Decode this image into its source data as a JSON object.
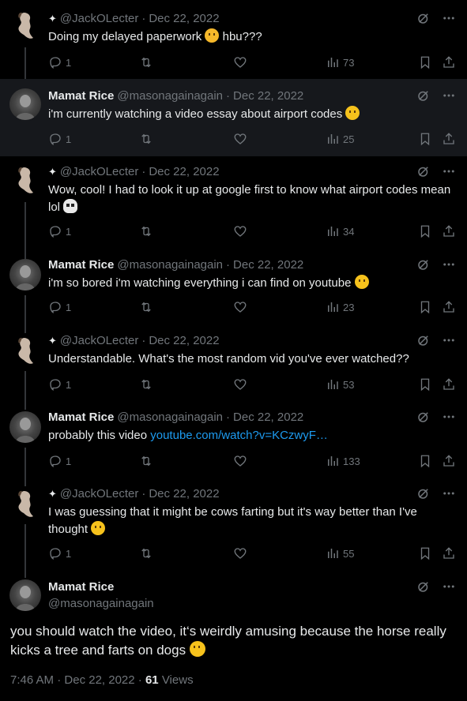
{
  "colors": {
    "background": "#000000",
    "highlight": "#16181c",
    "text": "#e7e9ea",
    "muted": "#71767b",
    "link": "#1d9bf0"
  },
  "replies": [
    {
      "author": "jack",
      "name": "",
      "handle": "@JackOLecter",
      "date": "Dec 22, 2022",
      "text": "Doing my delayed paperwork",
      "emoji": "yawning-face",
      "text_after": " hbu???",
      "replies": "1",
      "views": "73"
    },
    {
      "author": "mamat",
      "name": "Mamat Rice",
      "handle": "@masonagainagain",
      "date": "Dec 22, 2022",
      "text": "i'm currently watching a video essay about airport codes",
      "emoji": "grinning-face",
      "text_after": "",
      "replies": "1",
      "views": "25"
    },
    {
      "author": "jack",
      "name": "",
      "handle": "@JackOLecter",
      "date": "Dec 22, 2022",
      "text": "Wow, cool! I had to look it up at google first to know what airport codes mean lol",
      "emoji": "skull",
      "text_after": "",
      "replies": "1",
      "views": "34"
    },
    {
      "author": "mamat",
      "name": "Mamat Rice",
      "handle": "@masonagainagain",
      "date": "Dec 22, 2022",
      "text": "i'm so bored i'm watching everything i can find on youtube",
      "emoji": "tears-of-joy",
      "text_after": "",
      "replies": "1",
      "views": "23"
    },
    {
      "author": "jack",
      "name": "",
      "handle": "@JackOLecter",
      "date": "Dec 22, 2022",
      "text": "Understandable. What's the most random vid you've ever watched??",
      "emoji": "",
      "text_after": "",
      "replies": "1",
      "views": "53"
    },
    {
      "author": "mamat",
      "name": "Mamat Rice",
      "handle": "@masonagainagain",
      "date": "Dec 22, 2022",
      "text": "probably this video ",
      "link": "youtube.com/watch?v=KCzwyF…",
      "emoji": "",
      "text_after": "",
      "replies": "1",
      "views": "133"
    },
    {
      "author": "jack",
      "name": "",
      "handle": "@JackOLecter",
      "date": "Dec 22, 2022",
      "text": "I was guessing that it might be cows farting but it's way better than I've thought",
      "emoji": "crying-face",
      "text_after": "",
      "replies": "1",
      "views": "55"
    }
  ],
  "main": {
    "name": "Mamat Rice",
    "handle": "@masonagainagain",
    "text": "you should watch the video, it‘s weirdly amusing because the horse really kicks a tree and farts on dogs",
    "emoji": "tears-of-joy",
    "time": "7:46 AM",
    "date": "Dec 22, 2022",
    "views_count": "61",
    "views_label": "Views"
  },
  "separators": {
    "dot": "·"
  }
}
